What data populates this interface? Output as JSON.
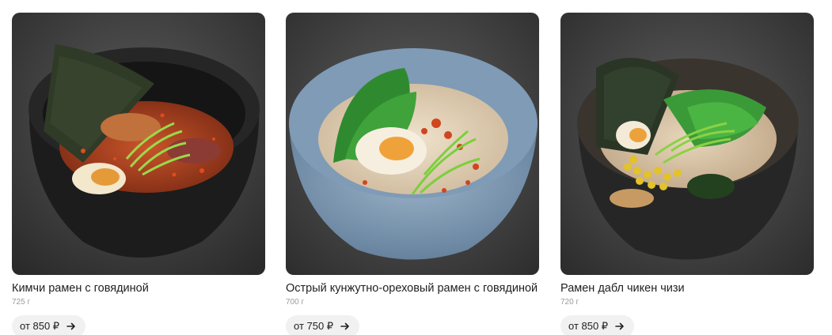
{
  "products": [
    {
      "name": "Кимчи рамен с говядиной",
      "weight": "725 г",
      "price_label": "от 850 ₽",
      "image": "kimchi-ramen-beef-photo"
    },
    {
      "name": "Острый кунжутно-ореховый рамен с говядиной",
      "weight": "700 г",
      "price_label": "от 750 ₽",
      "image": "spicy-sesame-nut-ramen-photo"
    },
    {
      "name": "Рамен дабл чикен чизи",
      "weight": "720 г",
      "price_label": "от 850 ₽",
      "image": "double-chicken-cheesy-ramen-photo"
    }
  ],
  "colors": {
    "price_button_bg": "#f1f1f1",
    "weight_text": "#9a9a9a",
    "name_text": "#1f1f1f"
  },
  "icons": {
    "price_arrow": "arrow-right-icon"
  }
}
